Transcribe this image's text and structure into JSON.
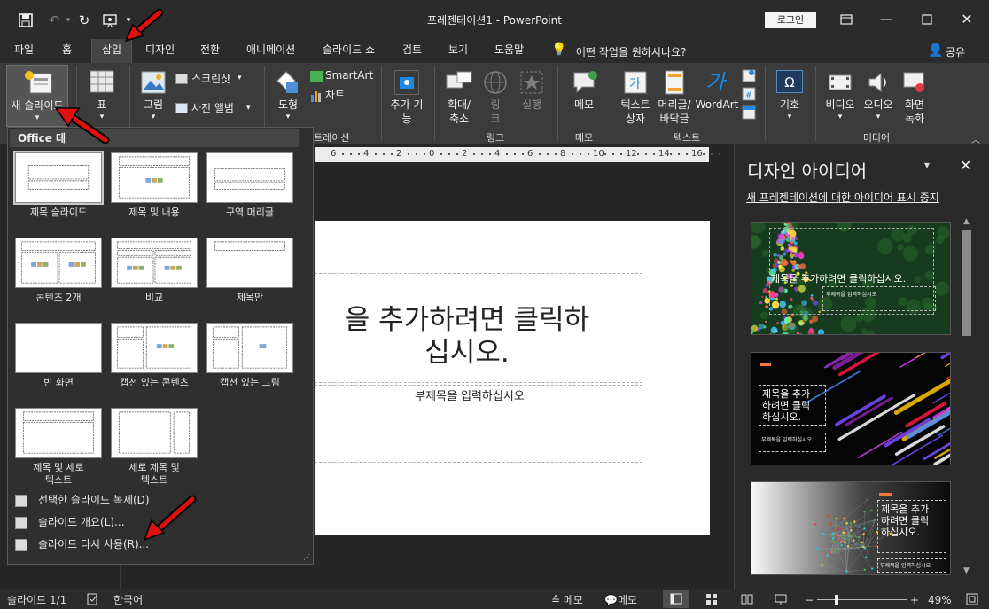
{
  "window": {
    "title": "프레젠테이션1  -  PowerPoint",
    "login_label": "로그인"
  },
  "tabs": [
    {
      "label": "파일"
    },
    {
      "label": "홈"
    },
    {
      "label": "삽입"
    },
    {
      "label": "디자인"
    },
    {
      "label": "전환"
    },
    {
      "label": "애니메이션"
    },
    {
      "label": "슬라이드 쇼"
    },
    {
      "label": "검토"
    },
    {
      "label": "보기"
    },
    {
      "label": "도움말"
    }
  ],
  "active_tab": "삽입",
  "tell_me": "어떤 작업을 원하시나요?",
  "share_label": "공유",
  "ribbon": {
    "new_slide": "새 슬라이드",
    "table": "표",
    "picture": "그림",
    "screenshot": "스크린샷",
    "photo_album": "사진 앨범",
    "shapes": "도형",
    "smartart": "SmartArt",
    "chart": "차트",
    "addins_1": "추가 기",
    "addins_2": "능",
    "zoom_1": "확대/",
    "zoom_2": "축소",
    "link_1": "링",
    "link_2": "크",
    "action": "실행",
    "comment": "메모",
    "textbox_1": "텍스트",
    "textbox_2": "상자",
    "header_1": "머리글/",
    "header_2": "바닥글",
    "wordart": "WordArt",
    "symbol": "기호",
    "video": "비디오",
    "audio": "오디오",
    "screen_rec_1": "화면",
    "screen_rec_2": "녹화",
    "groups": {
      "illustrations_tail": "트레이션",
      "links": "링크",
      "comments": "메모",
      "text": "텍스트",
      "media": "미디어"
    }
  },
  "ruler_numbers": [
    "6",
    "4",
    "2",
    "0",
    "2",
    "4",
    "6",
    "8",
    "10",
    "12",
    "14",
    "16"
  ],
  "slide": {
    "title": "을 추가하려면 클릭하\n십시오.",
    "subtitle": "부제목을 입력하십시오"
  },
  "dropdown": {
    "header": "Office 테",
    "layouts": [
      {
        "label": "제목 슬라이드"
      },
      {
        "label": "제목 및 내용"
      },
      {
        "label": "구역 머리글"
      },
      {
        "label": "콘텐츠 2개"
      },
      {
        "label": "비교"
      },
      {
        "label": "제목만"
      },
      {
        "label": "빈 화면"
      },
      {
        "label": "캡션 있는 콘텐츠"
      },
      {
        "label": "캡션 있는 그림"
      },
      {
        "label": "제목 및 세로\n텍스트"
      },
      {
        "label": "세로 제목 및\n텍스트"
      }
    ],
    "commands": [
      {
        "label": "선택한 슬라이드 복제(D)"
      },
      {
        "label": "슬라이드 개요(L)..."
      },
      {
        "label": "슬라이드 다시 사용(R)..."
      }
    ]
  },
  "design_pane": {
    "title": "디자인 아이디어",
    "stop_link": "새 프레젠테이션에 대한 아이디어 표시 중지",
    "ideas": [
      {
        "title": "제목을 추가하려면 클릭하십시오.",
        "subtitle": "부제목을 입력하십시오"
      },
      {
        "title": "제목을 추가\n하려면 클릭\n하십시오.",
        "subtitle": "부제목을 입력하십시오"
      },
      {
        "title": "제목을 추가\n하려면 클릭\n하십시오.",
        "subtitle": "부제목을 입력하십시오"
      }
    ]
  },
  "status": {
    "slide_count": "슬라이드 1/1",
    "language": "한국어",
    "notes": "메모",
    "comments": "메모",
    "zoom": "49%"
  },
  "colors": {
    "annotation_arrow": "#e01010",
    "ribbon_bg": "#3b3b3b",
    "titlebar_bg": "#2b2b2b"
  }
}
